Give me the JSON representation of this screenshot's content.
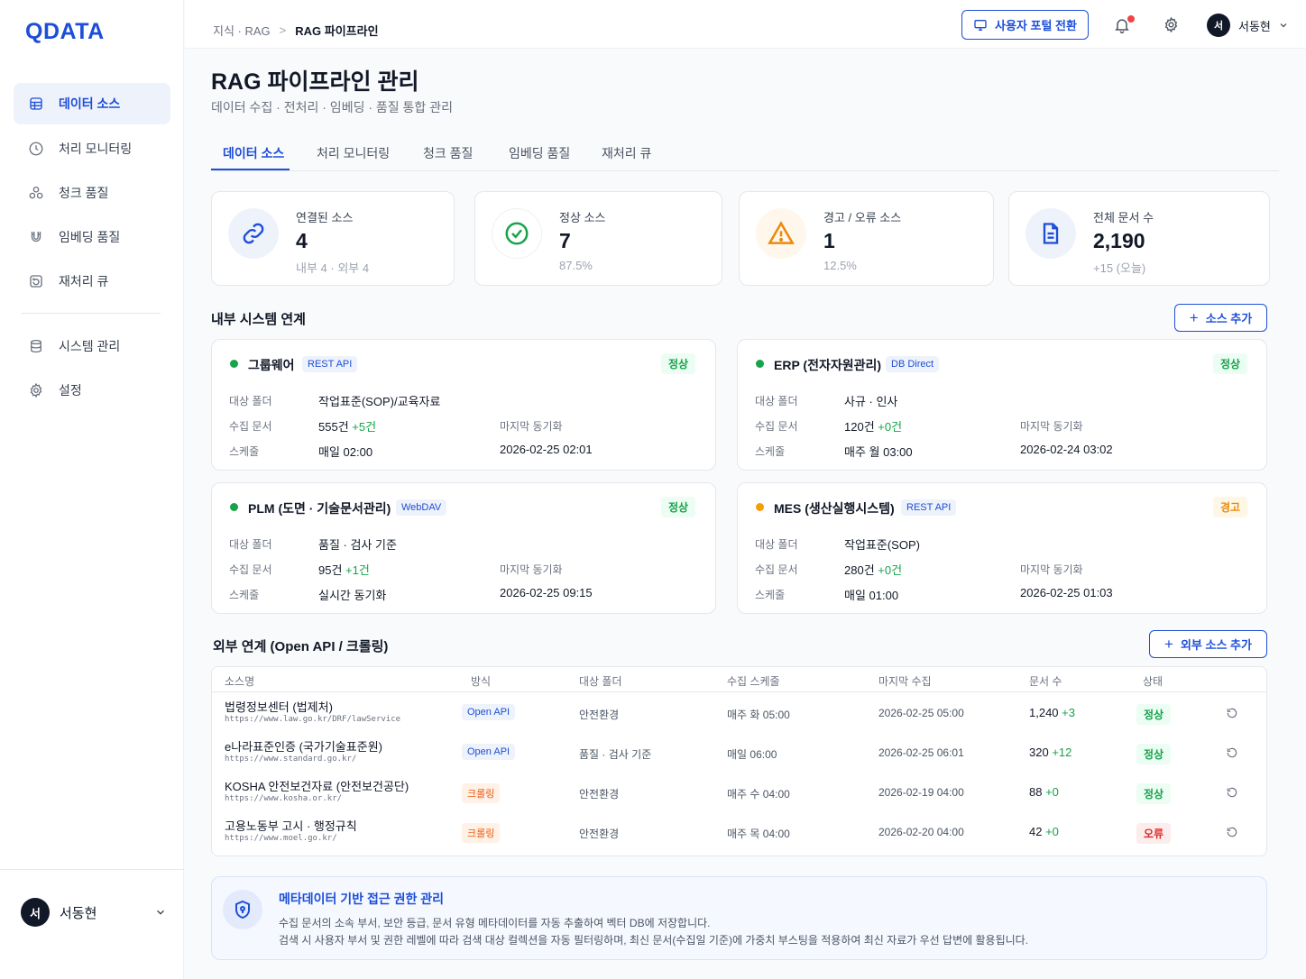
{
  "brand": {
    "logo": "QDATA",
    "accent": "#1d4ed8"
  },
  "sidebar": {
    "items": [
      {
        "label": "데이터 소스",
        "icon": "database-icon",
        "active": true
      },
      {
        "label": "처리 모니터링",
        "icon": "clock-icon"
      },
      {
        "label": "청크 품질",
        "icon": "chunks-icon"
      },
      {
        "label": "임베딩 품질",
        "icon": "magnet-icon"
      },
      {
        "label": "재처리 큐",
        "icon": "queue-icon"
      },
      {
        "label": "시스템 관리",
        "icon": "server-icon"
      },
      {
        "label": "설정",
        "icon": "gear-icon"
      }
    ],
    "user": {
      "initial": "서",
      "name": "서동현"
    }
  },
  "topbar": {
    "breadcrumb": {
      "parent": "지식 · RAG",
      "sep": ">",
      "current": "RAG 파이프라인"
    },
    "portal_button": "사용자 포털 전환",
    "user": {
      "initial": "서",
      "name": "서동현"
    }
  },
  "page": {
    "title": "RAG 파이프라인 관리",
    "subtitle": "데이터 수집 · 전처리 · 임베딩 · 품질 통합 관리"
  },
  "tabs": [
    "데이터 소스",
    "처리 모니터링",
    "청크 품질",
    "임베딩 품질",
    "재처리 큐"
  ],
  "stats": [
    {
      "label": "연결된 소스",
      "value": "4",
      "sub": "내부 4 · 외부 4",
      "icon": "link-icon",
      "color": "#1d4ed8"
    },
    {
      "label": "정상 소스",
      "value": "7",
      "sub": "87.5%",
      "icon": "check-circle-icon",
      "color": "#16a34a"
    },
    {
      "label": "경고 / 오류 소스",
      "value": "1",
      "sub": "12.5%",
      "icon": "warning-icon",
      "color": "#ea8a0b"
    },
    {
      "label": "전체 문서 수",
      "value": "2,190",
      "sub": "+15 (오늘)",
      "icon": "document-icon",
      "color": "#1d4ed8"
    }
  ],
  "internal": {
    "title": "내부 시스템 연계",
    "add_label": "소스 추가",
    "labels": {
      "folder": "대상 폴더",
      "docs": "수집 문서",
      "schedule": "스케줄",
      "last_sync": "마지막 동기화"
    },
    "cards": [
      {
        "name": "그룹웨어",
        "tag": "REST API",
        "status": "정상",
        "folder": "작업표준(SOP)/교육자료",
        "docs": "555건",
        "delta": "+5건",
        "schedule": "매일 02:00",
        "last_sync": "2026-02-25 02:01"
      },
      {
        "name": "ERP (전자자원관리)",
        "tag": "DB Direct",
        "status": "정상",
        "folder": "사규 · 인사",
        "docs": "120건",
        "delta": "+0건",
        "schedule": "매주 월 03:00",
        "last_sync": "2026-02-24 03:02"
      },
      {
        "name": "PLM (도면 · 기술문서관리)",
        "tag": "WebDAV",
        "status": "정상",
        "folder": "품질 · 검사 기준",
        "docs": "95건",
        "delta": "+1건",
        "schedule": "실시간 동기화",
        "last_sync": "2026-02-25 09:15"
      },
      {
        "name": "MES (생산실행시스템)",
        "tag": "REST API",
        "status": "경고",
        "folder": "작업표준(SOP)",
        "docs": "280건",
        "delta": "+0건",
        "schedule": "매일 01:00",
        "last_sync": "2026-02-25 01:03"
      }
    ]
  },
  "external": {
    "title": "외부 연계 (Open API / 크롤링)",
    "add_label": "외부 소스 추가",
    "columns": [
      "소스명",
      "방식",
      "대상 폴더",
      "수집 스케줄",
      "마지막 수집",
      "문서 수",
      "상태"
    ],
    "rows": [
      {
        "name": "법령정보센터 (법제처)",
        "url": "https://www.law.go.kr/DRF/lawService",
        "method": "Open API",
        "folder": "안전환경",
        "schedule": "매주 화 05:00",
        "last": "2026-02-25 05:00",
        "count": "1,240",
        "delta": "+3",
        "status": "정상"
      },
      {
        "name": "e나라표준인증 (국가기술표준원)",
        "url": "https://www.standard.go.kr/",
        "method": "Open API",
        "folder": "품질 · 검사 기준",
        "schedule": "매일 06:00",
        "last": "2026-02-25 06:01",
        "count": "320",
        "delta": "+12",
        "status": "정상"
      },
      {
        "name": "KOSHA 안전보건자료 (안전보건공단)",
        "url": "https://www.kosha.or.kr/",
        "method": "크롤링",
        "folder": "안전환경",
        "schedule": "매주 수 04:00",
        "last": "2026-02-19 04:00",
        "count": "88",
        "delta": "+0",
        "status": "정상"
      },
      {
        "name": "고용노동부 고시 · 행정규칙",
        "url": "https://www.moel.go.kr/",
        "method": "크롤링",
        "folder": "안전환경",
        "schedule": "매주 목 04:00",
        "last": "2026-02-20 04:00",
        "count": "42",
        "delta": "+0",
        "status": "오류"
      }
    ]
  },
  "info": {
    "title": "메타데이터 기반 접근 권한 관리",
    "line1": "수집 문서의 소속 부서, 보안 등급, 문서 유형 메타데이터를 자동 추출하여 벡터 DB에 저장합니다.",
    "line2": "검색 시 사용자 부서 및 권한 레벨에 따라 검색 대상 컬렉션을 자동 필터링하며, 최신 문서(수집일 기준)에 가중치 부스팅을 적용하여 최신 자료가 우선 답변에 활용됩니다."
  }
}
